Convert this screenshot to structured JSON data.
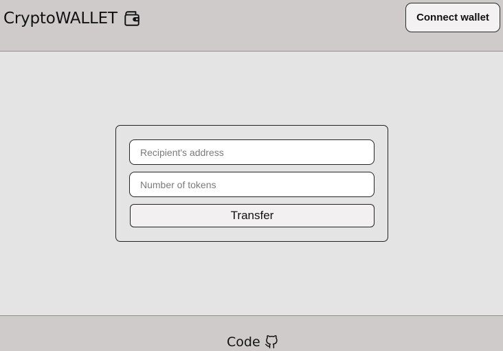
{
  "header": {
    "title": "CryptoWALLET",
    "title_icon": "wallet-icon",
    "connect_label": "Connect wallet"
  },
  "transfer": {
    "recipient_placeholder": "Recipient's address",
    "recipient_value": "",
    "tokens_placeholder": "Number of tokens",
    "tokens_value": "",
    "submit_label": "Transfer"
  },
  "footer": {
    "link_label": "Code",
    "link_icon": "github-icon"
  },
  "colors": {
    "header_bg": "#cfcbca",
    "main_bg": "#e4e4e4",
    "footer_bg": "#cfcbca",
    "button_bg": "#f3f1f1",
    "border": "#222222"
  }
}
